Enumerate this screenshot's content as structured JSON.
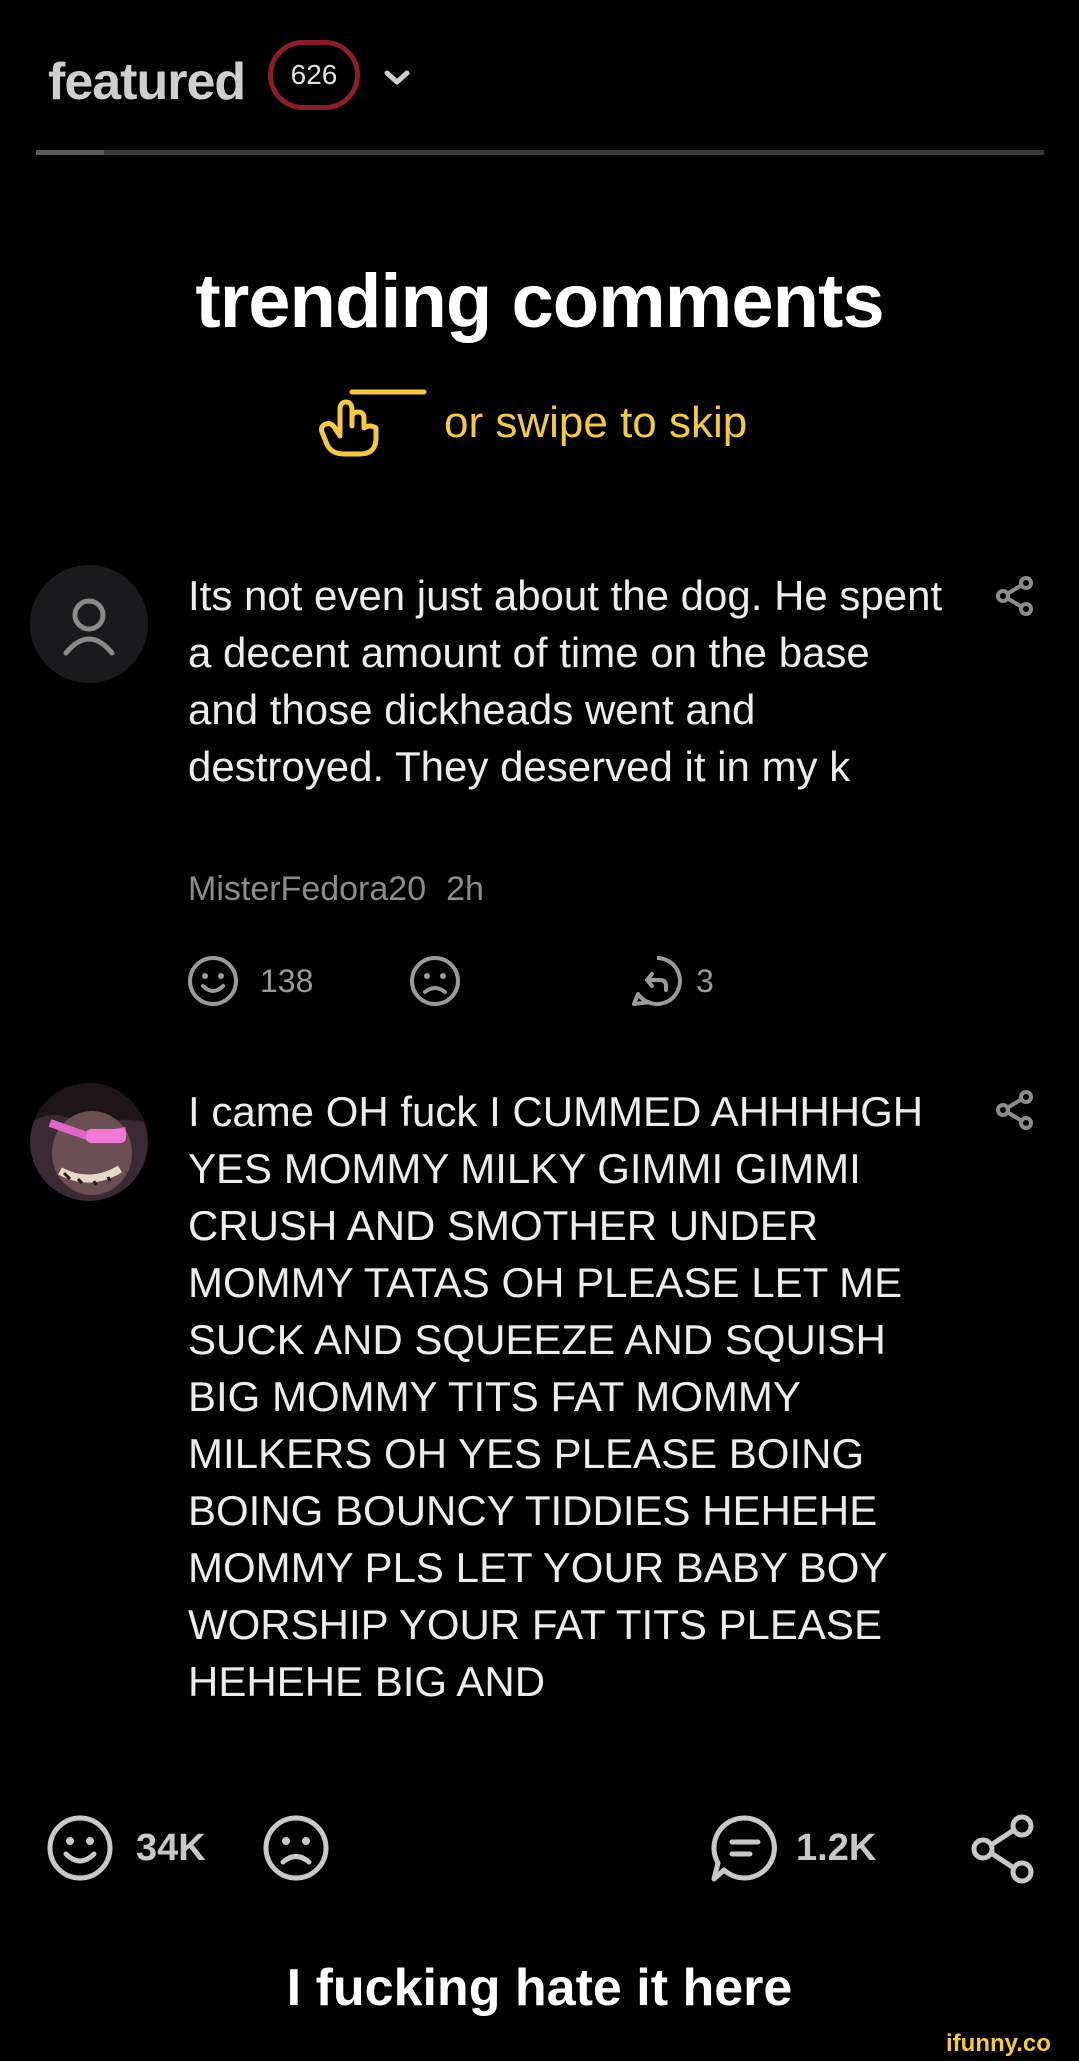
{
  "header": {
    "title": "featured",
    "badge_count": "626"
  },
  "trending": {
    "title": "trending comments",
    "swipe_hint": "or swipe to skip"
  },
  "comments": [
    {
      "text": "Its not even just about the dog. He spent a decent amount of time on the base and those dickheads went and destroyed. They deserved it in my k",
      "username": "MisterFedora20",
      "time": "2h",
      "smiles": "138",
      "replies": "3"
    },
    {
      "text": "I came OH fuck I CUMMED AHHHHGH YES MOMMY MILKY GIMMI GIMMI CRUSH AND SMOTHER UNDER MOMMY TATAS OH PLEASE LET ME SUCK AND SQUEEZE AND SQUISH BIG MOMMY TITS FAT MOMMY MILKERS OH YES PLEASE BOING BOING BOUNCY TIDDIES HEHEHE MOMMY PLS LET YOUR BABY BOY WORSHIP YOUR FAT TITS PLEASE HEHEHE BIG AND"
    }
  ],
  "post_actions": {
    "smiles": "34K",
    "comments": "1.2K"
  },
  "caption": "I fucking hate it here",
  "watermark": "ifunny.co",
  "colors": {
    "accent": "#f3c846",
    "badge_border": "#8a1f2c",
    "background": "#000000"
  }
}
